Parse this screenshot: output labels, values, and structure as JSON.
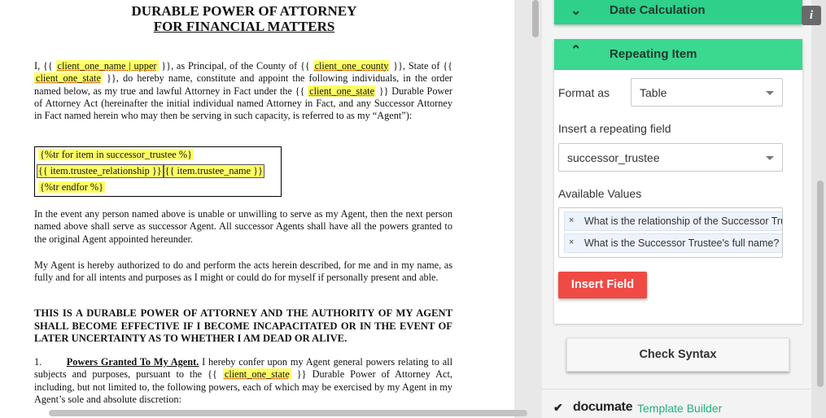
{
  "document": {
    "title_line1": "DURABLE POWER OF ATTORNEY",
    "title_line2": "FOR FINANCIAL MATTERS",
    "p1": [
      {
        "text": "I, {{ "
      },
      {
        "field": "client_one_name | upper"
      },
      {
        "text": " }}, as Principal, of the County of {{ "
      },
      {
        "field": "client_one_county"
      },
      {
        "text": " }}, State of {{ "
      },
      {
        "field": "client_one_state"
      },
      {
        "text": " }}, do hereby name, constitute and appoint the following individuals, in the order named below, as my true and lawful Attorney in Fact under the {{ "
      },
      {
        "field": "client_one_state"
      },
      {
        "text": " }} Durable Power of Attorney Act (hereinafter the initial individual named Attorney in Fact, and any Successor Attorney in Fact named herein who may then be serving in such capacity, is referred to as my “Agent”):"
      }
    ],
    "table": {
      "row1": "{%tr for item in successor_trustee %}",
      "row2_cell1": "{{ item.trustee_relationship }}",
      "row2_cell2": "{{ item.trustee_name }}",
      "row3": "{%tr endfor %}"
    },
    "p2": "In the event any person named above is unable or unwilling to serve as my Agent, then the next person named above shall serve as successor Agent.  All successor Agents shall have all the powers granted to the original Agent appointed hereunder.",
    "p3": "My Agent is hereby authorized to do and perform the acts herein described, for me and in my name, as fully and for all intents and purposes as I might or could do for myself if personally present and able.",
    "p4": "THIS IS A DURABLE POWER OF ATTORNEY AND THE AUTHORITY OF MY AGENT SHALL BECOME EFFECTIVE IF I BECOME INCAPACITATED OR IN THE EVENT OF LATER UNCERTAINTY AS TO WHETHER I AM DEAD OR ALIVE.",
    "p5_num": "1.",
    "p5_heading": "Powers Granted To My Agent.",
    "p5": [
      {
        "text": " I hereby confer upon my Agent general powers relating to all subjects and purposes, pursuant to the {{ "
      },
      {
        "field": "client_one_state"
      },
      {
        "text": " }} Durable Power of Attorney Act, including, but not limited to, the following powers, each of which may be exercised by my Agent in my Agent’s sole and absolute discretion:"
      }
    ]
  },
  "panel": {
    "accordion_date": "Date Calculation",
    "accordion_repeat": "Repeating Item",
    "format_label": "Format as",
    "format_value": "Table",
    "insert_label": "Insert a repeating field",
    "insert_value": "successor_trustee",
    "available_label": "Available Values",
    "available_values": [
      "What is the relationship of the Successor Trustee to you?",
      "What is the Successor Trustee's full name?"
    ],
    "remove_glyph": "×",
    "insert_button": "Insert Field",
    "check_button": "Check Syntax",
    "brand": "documate",
    "brand_sub": "Template Builder",
    "info_glyph": "i",
    "chevron_down": "⌄",
    "chevron_up": "⌃",
    "colors": {
      "accordion": "#2fd08a",
      "insert_button": "#f04a44",
      "merge_highlight": "#ffff66"
    }
  }
}
